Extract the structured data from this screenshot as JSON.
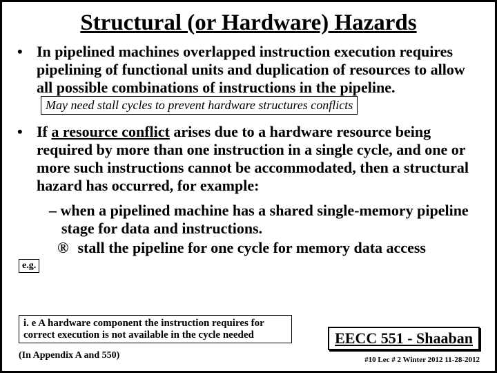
{
  "title": "Structural (or Hardware) Hazards",
  "bullets": {
    "b1_text": "In pipelined machines  overlapped instruction execution requires pipelining of functional units and duplication of resources to allow all possible combinations of instructions in the pipeline.",
    "b1_boxnote": "May need stall cycles to prevent hardware structures conflicts",
    "b2_pre": "If ",
    "b2_underlined": "a resource conflict",
    "b2_post": " arises due to a hardware resource being required by more than one instruction in a single cycle, and one or more such instructions cannot be accommodated,  then a structural hazard has occurred, for example:"
  },
  "eg_label": "e.g.",
  "sub_bullet": "– when a pipelined machine has a shared single-memory pipeline stage for data and instructions.",
  "arrow_symbol": "®",
  "arrow_text": " stall the pipeline for one cycle for memory data access",
  "bottom_note": "i. e A hardware component the instruction requires for correct execution is not available in the cycle needed",
  "appendix": "(In  Appendix A and 550)",
  "course": "EECC 551 - Shaaban",
  "footer": "#10   Lec # 2   Winter 2012   11-28-2012"
}
